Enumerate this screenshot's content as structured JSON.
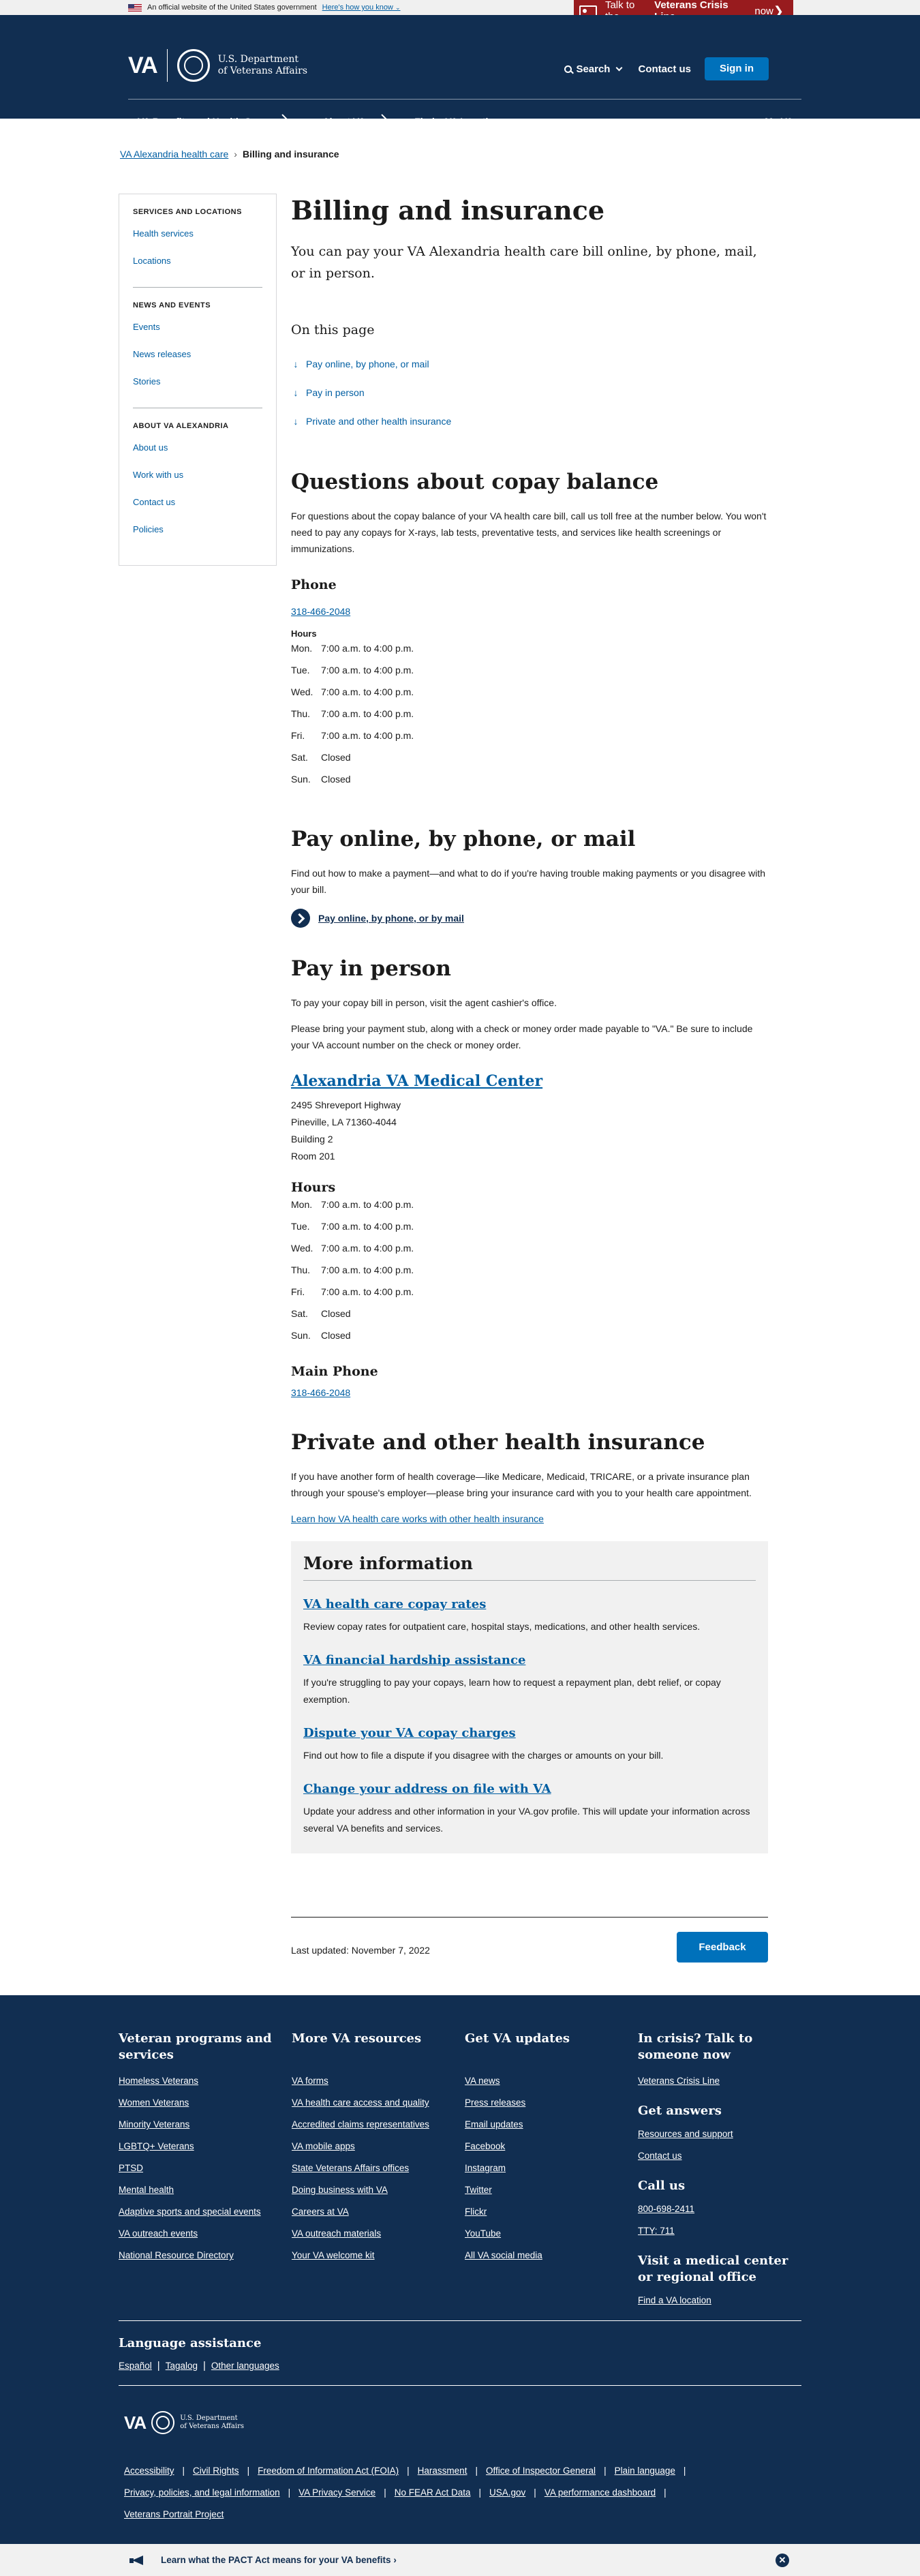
{
  "banner": {
    "official_text": "An official website of the United States government",
    "how_link": "Here's how you know"
  },
  "crisis": {
    "prefix": "Talk to the",
    "bold": "Veterans Crisis Line",
    "suffix": "now"
  },
  "header": {
    "logo_text": "VA",
    "dept_line1": "U.S. Department",
    "dept_line2": "of Veterans Affairs",
    "search": "Search",
    "contact": "Contact us",
    "signin": "Sign in"
  },
  "nav": {
    "items": [
      "VA Benefits and Health Care",
      "About VA",
      "Find a VA Location"
    ],
    "my_va": "My VA"
  },
  "breadcrumb": {
    "parent": "VA Alexandria health care",
    "current": "Billing and insurance"
  },
  "sidenav": {
    "sections": [
      {
        "title": "SERVICES AND LOCATIONS",
        "links": [
          "Health services",
          "Locations"
        ]
      },
      {
        "title": "NEWS AND EVENTS",
        "links": [
          "Events",
          "News releases",
          "Stories"
        ]
      },
      {
        "title": "ABOUT VA ALEXANDRIA",
        "links": [
          "About us",
          "Work with us",
          "Contact us",
          "Policies"
        ]
      }
    ]
  },
  "page": {
    "title": "Billing and insurance",
    "lead": "You can pay your VA Alexandria health care bill online, by phone, mail, or in person.",
    "on_this_page": "On this page",
    "otp_links": [
      "Pay online, by phone, or mail",
      "Pay in person",
      "Private and other health insurance"
    ]
  },
  "copay": {
    "heading": "Questions about copay balance",
    "text": "For questions about the copay balance of your VA health care bill, call us toll free at the number below. You won't need to pay any copays for X-rays, lab tests, preventative tests, and services like health screenings or immunizations.",
    "phone_heading": "Phone",
    "phone": "318-466-2048",
    "hours_label": "Hours",
    "hours": [
      {
        "day": "Mon.",
        "time": "7:00 a.m. to 4:00 p.m."
      },
      {
        "day": "Tue.",
        "time": "7:00 a.m. to 4:00 p.m."
      },
      {
        "day": "Wed.",
        "time": "7:00 a.m. to 4:00 p.m."
      },
      {
        "day": "Thu.",
        "time": "7:00 a.m. to 4:00 p.m."
      },
      {
        "day": "Fri.",
        "time": "7:00 a.m. to 4:00 p.m."
      },
      {
        "day": "Sat.",
        "time": "Closed"
      },
      {
        "day": "Sun.",
        "time": "Closed"
      }
    ]
  },
  "pay_online": {
    "heading": "Pay online, by phone, or mail",
    "text": "Find out how to make a payment—and what to do if you're having trouble making payments or you disagree with your bill.",
    "link": "Pay online, by phone, or by mail"
  },
  "pay_in_person": {
    "heading": "Pay in person",
    "text1": "To pay your copay bill in person, visit the agent cashier's office.",
    "text2": "Please bring your payment stub, along with a check or money order made payable to \"VA.\" Be sure to include your VA account number on the check or money order.",
    "facility": "Alexandria VA Medical Center",
    "address": [
      "2495 Shreveport Highway",
      "Pineville, LA 71360-4044",
      "Building 2",
      "Room 201"
    ],
    "hours_heading": "Hours",
    "hours": [
      {
        "day": "Mon.",
        "time": "7:00 a.m. to 4:00 p.m."
      },
      {
        "day": "Tue.",
        "time": "7:00 a.m. to 4:00 p.m."
      },
      {
        "day": "Wed.",
        "time": "7:00 a.m. to 4:00 p.m."
      },
      {
        "day": "Thu.",
        "time": "7:00 a.m. to 4:00 p.m."
      },
      {
        "day": "Fri.",
        "time": "7:00 a.m. to 4:00 p.m."
      },
      {
        "day": "Sat.",
        "time": "Closed"
      },
      {
        "day": "Sun.",
        "time": "Closed"
      }
    ],
    "main_phone_heading": "Main Phone",
    "main_phone": "318-466-2048"
  },
  "insurance": {
    "heading": "Private and other health insurance",
    "text": "If you have another form of health coverage—like Medicare, Medicaid, TRICARE, or a private insurance plan through your spouse's employer—please bring your insurance card with you to your health care appointment.",
    "link": "Learn how VA health care works with other health insurance"
  },
  "more_info": {
    "heading": "More information",
    "items": [
      {
        "title": "VA health care copay rates",
        "desc": "Review copay rates for outpatient care, hospital stays, medications, and other health services."
      },
      {
        "title": "VA financial hardship assistance",
        "desc": "If you're struggling to pay your copays, learn how to request a repayment plan, debt relief, or copay exemption."
      },
      {
        "title": "Dispute your VA copay charges",
        "desc": "Find out how to file a dispute if you disagree with the charges or amounts on your bill."
      },
      {
        "title": "Change your address on file with VA",
        "desc": "Update your address and other information in your VA.gov profile. This will update your information across several VA benefits and services."
      }
    ]
  },
  "last_updated": "Last updated: November 7, 2022",
  "feedback": "Feedback",
  "footer": {
    "col1": {
      "title": "Veteran programs and services",
      "links": [
        "Homeless Veterans",
        "Women Veterans",
        "Minority Veterans",
        "LGBTQ+ Veterans",
        "PTSD",
        "Mental health",
        "Adaptive sports and special events",
        "VA outreach events",
        "National Resource Directory"
      ]
    },
    "col2": {
      "title": "More VA resources",
      "links": [
        "VA forms",
        "VA health care access and quality",
        "Accredited claims representatives",
        "VA mobile apps",
        "State Veterans Affairs offices",
        "Doing business with VA",
        "Careers at VA",
        "VA outreach materials",
        "Your VA welcome kit"
      ]
    },
    "col3": {
      "title": "Get VA updates",
      "links": [
        "VA news",
        "Press releases",
        "Email updates",
        "Facebook",
        "Instagram",
        "Twitter",
        "Flickr",
        "YouTube",
        "All VA social media"
      ]
    },
    "col4": {
      "crisis_title": "In crisis? Talk to someone now",
      "crisis_link": "Veterans Crisis Line",
      "answers_title": "Get answers",
      "answers_links": [
        "Resources and support",
        "Contact us"
      ],
      "call_title": "Call us",
      "call_links": [
        "800-698-2411",
        "TTY: 711"
      ],
      "visit_title": "Visit a medical center or regional office",
      "visit_link": "Find a VA location"
    },
    "language": {
      "title": "Language assistance",
      "links": [
        "Español",
        "Tagalog",
        "Other languages"
      ]
    },
    "bottom_links": [
      "Accessibility",
      "Civil Rights",
      "Freedom of Information Act (FOIA)",
      "Harassment",
      "Office of Inspector General",
      "Plain language",
      "Privacy, policies, and legal information",
      "VA Privacy Service",
      "No FEAR Act Data",
      "USA.gov",
      "VA performance dashboard",
      "Veterans Portrait Project"
    ]
  },
  "pact": {
    "text": "Learn what the PACT Act means for your VA benefits"
  }
}
